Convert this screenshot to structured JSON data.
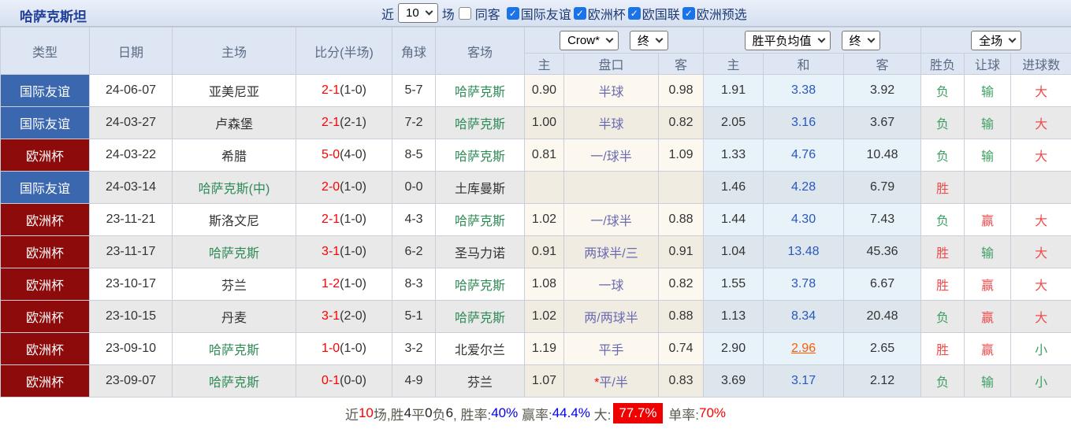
{
  "topbar": {
    "title": "哈萨克斯坦",
    "recent_label": "近",
    "recent_value": "10",
    "matches_label": "场",
    "same_away_label": "同客",
    "same_away_checked": false,
    "check_glyph": "✓",
    "filters": [
      {
        "label": "国际友谊",
        "checked": true
      },
      {
        "label": "欧洲杯",
        "checked": true
      },
      {
        "label": "欧国联",
        "checked": true
      },
      {
        "label": "欧洲预选",
        "checked": true
      }
    ]
  },
  "header": {
    "type": "类型",
    "date": "日期",
    "home": "主场",
    "score": "比分(半场)",
    "corner": "角球",
    "away": "客场",
    "ah_select1": "Crow*",
    "ah_select2": "终",
    "eu_select1": "胜平负均值",
    "eu_select2": "终",
    "ft_select": "全场",
    "sub": {
      "ah_home": "主",
      "ah_line": "盘口",
      "ah_away": "客",
      "eu_home": "主",
      "eu_draw": "和",
      "eu_away": "客",
      "wl": "胜负",
      "handicap": "让球",
      "goals": "进球数"
    }
  },
  "colors": {
    "friendly_badge": "#3b67ae",
    "eurocup_badge": "#8e0b0b",
    "team_green": "#2e8b57",
    "score_red": "#fe0000",
    "line_purple": "#6a6ab2",
    "draw_blue": "#2a57c0",
    "highlight_orange": "#ff5a00",
    "result_red": "#ee4d4d",
    "result_green": "#3f9e63"
  },
  "rows": [
    {
      "type": "国际友谊",
      "type_color": "b",
      "date": "24-06-07",
      "home": "亚美尼亚",
      "home_green": false,
      "score": "2-1",
      "half": "(1-0)",
      "corner": "5-7",
      "away": "哈萨克斯",
      "away_green": true,
      "ah_home": "0.90",
      "line_star": "",
      "line": "半球",
      "ah_away": "0.98",
      "eu_home": "1.91",
      "eu_draw": "3.38",
      "draw_hl": false,
      "eu_away": "3.92",
      "wl": "负",
      "handicap": "输",
      "goals": "大"
    },
    {
      "type": "国际友谊",
      "type_color": "b",
      "date": "24-03-27",
      "home": "卢森堡",
      "home_green": false,
      "score": "2-1",
      "half": "(2-1)",
      "corner": "7-2",
      "away": "哈萨克斯",
      "away_green": true,
      "ah_home": "1.00",
      "line_star": "",
      "line": "半球",
      "ah_away": "0.82",
      "eu_home": "2.05",
      "eu_draw": "3.16",
      "draw_hl": false,
      "eu_away": "3.67",
      "wl": "负",
      "handicap": "输",
      "goals": "大"
    },
    {
      "type": "欧洲杯",
      "type_color": "r",
      "date": "24-03-22",
      "home": "希腊",
      "home_green": false,
      "score": "5-0",
      "half": "(4-0)",
      "corner": "8-5",
      "away": "哈萨克斯",
      "away_green": true,
      "ah_home": "0.81",
      "line_star": "",
      "line": "一/球半",
      "ah_away": "1.09",
      "eu_home": "1.33",
      "eu_draw": "4.76",
      "draw_hl": false,
      "eu_away": "10.48",
      "wl": "负",
      "handicap": "输",
      "goals": "大"
    },
    {
      "type": "国际友谊",
      "type_color": "b",
      "date": "24-03-14",
      "home": "哈萨克斯(中)",
      "home_green": true,
      "score": "2-0",
      "half": "(1-0)",
      "corner": "0-0",
      "away": "土库曼斯",
      "away_green": false,
      "ah_home": "",
      "line_star": "",
      "line": "",
      "ah_away": "",
      "eu_home": "1.46",
      "eu_draw": "4.28",
      "draw_hl": false,
      "eu_away": "6.79",
      "wl": "胜",
      "handicap": "",
      "goals": ""
    },
    {
      "type": "欧洲杯",
      "type_color": "r",
      "date": "23-11-21",
      "home": "斯洛文尼",
      "home_green": false,
      "score": "2-1",
      "half": "(1-0)",
      "corner": "4-3",
      "away": "哈萨克斯",
      "away_green": true,
      "ah_home": "1.02",
      "line_star": "",
      "line": "一/球半",
      "ah_away": "0.88",
      "eu_home": "1.44",
      "eu_draw": "4.30",
      "draw_hl": false,
      "eu_away": "7.43",
      "wl": "负",
      "handicap": "赢",
      "goals": "大"
    },
    {
      "type": "欧洲杯",
      "type_color": "r",
      "date": "23-11-17",
      "home": "哈萨克斯",
      "home_green": true,
      "score": "3-1",
      "half": "(1-0)",
      "corner": "6-2",
      "away": "圣马力诺",
      "away_green": false,
      "ah_home": "0.91",
      "line_star": "",
      "line": "两球半/三",
      "ah_away": "0.91",
      "eu_home": "1.04",
      "eu_draw": "13.48",
      "draw_hl": false,
      "eu_away": "45.36",
      "wl": "胜",
      "handicap": "输",
      "goals": "大"
    },
    {
      "type": "欧洲杯",
      "type_color": "r",
      "date": "23-10-17",
      "home": "芬兰",
      "home_green": false,
      "score": "1-2",
      "half": "(1-0)",
      "corner": "8-3",
      "away": "哈萨克斯",
      "away_green": true,
      "ah_home": "1.08",
      "line_star": "",
      "line": "一球",
      "ah_away": "0.82",
      "eu_home": "1.55",
      "eu_draw": "3.78",
      "draw_hl": false,
      "eu_away": "6.67",
      "wl": "胜",
      "handicap": "赢",
      "goals": "大"
    },
    {
      "type": "欧洲杯",
      "type_color": "r",
      "date": "23-10-15",
      "home": "丹麦",
      "home_green": false,
      "score": "3-1",
      "half": "(2-0)",
      "corner": "5-1",
      "away": "哈萨克斯",
      "away_green": true,
      "ah_home": "1.02",
      "line_star": "",
      "line": "两/两球半",
      "ah_away": "0.88",
      "eu_home": "1.13",
      "eu_draw": "8.34",
      "draw_hl": false,
      "eu_away": "20.48",
      "wl": "负",
      "handicap": "赢",
      "goals": "大"
    },
    {
      "type": "欧洲杯",
      "type_color": "r",
      "date": "23-09-10",
      "home": "哈萨克斯",
      "home_green": true,
      "score": "1-0",
      "half": "(1-0)",
      "corner": "3-2",
      "away": "北爱尔兰",
      "away_green": false,
      "ah_home": "1.19",
      "line_star": "",
      "line": "平手",
      "ah_away": "0.74",
      "eu_home": "2.90",
      "eu_draw": "2.96",
      "draw_hl": true,
      "eu_away": "2.65",
      "wl": "胜",
      "handicap": "赢",
      "goals": "小"
    },
    {
      "type": "欧洲杯",
      "type_color": "r",
      "date": "23-09-07",
      "home": "哈萨克斯",
      "home_green": true,
      "score": "0-1",
      "half": "(0-0)",
      "corner": "4-9",
      "away": "芬兰",
      "away_green": false,
      "ah_home": "1.07",
      "line_star": "*",
      "line": "平/半",
      "ah_away": "0.83",
      "eu_home": "3.69",
      "eu_draw": "3.17",
      "draw_hl": false,
      "eu_away": "2.12",
      "wl": "负",
      "handicap": "输",
      "goals": "小"
    }
  ],
  "footer": {
    "segments": [
      {
        "text": "近",
        "style": "label"
      },
      {
        "text": "10",
        "style": "red"
      },
      {
        "text": "场,胜",
        "style": "label"
      },
      {
        "text": "4",
        "style": "num"
      },
      {
        "text": "平",
        "style": "label"
      },
      {
        "text": "0",
        "style": "num"
      },
      {
        "text": "负",
        "style": "label"
      },
      {
        "text": "6",
        "style": "num"
      },
      {
        "text": ", 胜率:",
        "style": "label"
      },
      {
        "text": "40%",
        "style": "blue"
      },
      {
        "text": " 赢率:",
        "style": "label"
      },
      {
        "text": "44.4%",
        "style": "blue"
      },
      {
        "text": " 大:",
        "style": "label"
      },
      {
        "text": "77.7%",
        "style": "redbg"
      },
      {
        "text": " 单率:",
        "style": "label"
      },
      {
        "text": "70%",
        "style": "red"
      }
    ]
  }
}
